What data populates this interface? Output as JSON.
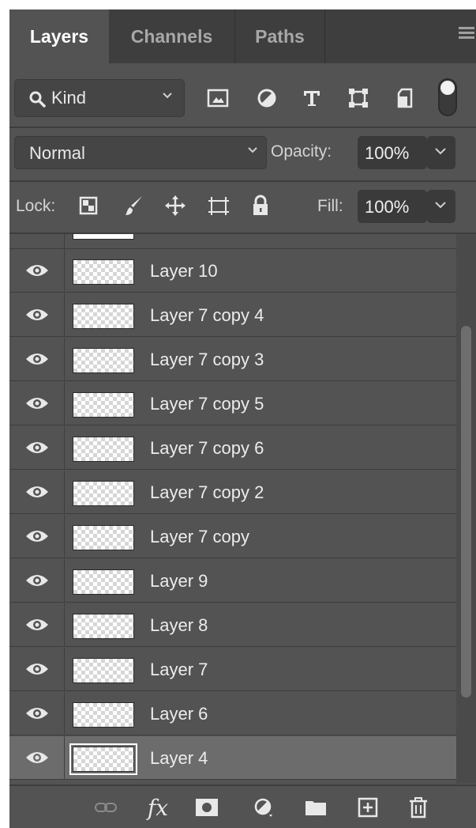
{
  "tabs": [
    {
      "label": "Layers",
      "active": true
    },
    {
      "label": "Channels",
      "active": false
    },
    {
      "label": "Paths",
      "active": false
    }
  ],
  "filter": {
    "kind_label": "Kind",
    "icons": [
      "image-filter-icon",
      "adjustment-filter-icon",
      "type-filter-icon",
      "shape-filter-icon",
      "smart-object-filter-icon"
    ]
  },
  "blend": {
    "mode": "Normal",
    "opacity_label": "Opacity:",
    "opacity_value": "100%"
  },
  "lock": {
    "label": "Lock:",
    "icons": [
      "lock-transparent-pixels-icon",
      "lock-image-pixels-icon",
      "lock-position-icon",
      "lock-artboard-icon",
      "lock-all-icon"
    ],
    "fill_label": "Fill:",
    "fill_value": "100%"
  },
  "layers": [
    {
      "name": "Layer 10",
      "visible": true
    },
    {
      "name": "Layer 7 copy 4",
      "visible": true
    },
    {
      "name": "Layer 7 copy 3",
      "visible": true
    },
    {
      "name": "Layer 7 copy 5",
      "visible": true
    },
    {
      "name": "Layer 7 copy 6",
      "visible": true
    },
    {
      "name": "Layer 7 copy 2",
      "visible": true
    },
    {
      "name": "Layer 7 copy",
      "visible": true
    },
    {
      "name": "Layer 9",
      "visible": true
    },
    {
      "name": "Layer 8",
      "visible": true
    },
    {
      "name": "Layer 7",
      "visible": true
    },
    {
      "name": "Layer 6",
      "visible": true
    },
    {
      "name": "Layer 4",
      "visible": true,
      "selected": true
    }
  ],
  "bottom_icons": [
    "link-layers-icon",
    "fx-icon",
    "layer-mask-icon",
    "adjustment-layer-icon",
    "new-group-icon",
    "new-layer-icon",
    "delete-layer-icon"
  ],
  "colors": {
    "panel": "#535353",
    "tab_bar": "#3e3e3e",
    "selected_row": "#6c6c6c"
  }
}
